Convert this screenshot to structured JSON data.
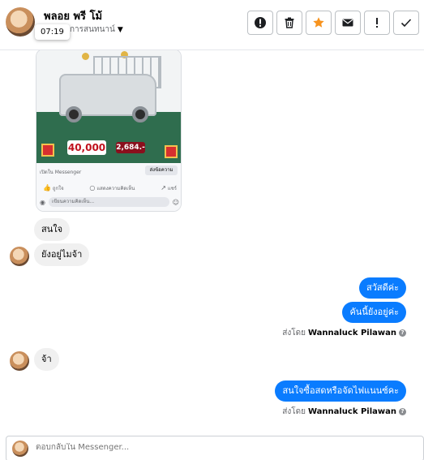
{
  "header": {
    "contact_name": "พลอย พรี โม้",
    "subtitle": "อการสนทนาน์",
    "tooltip_time": "07:19"
  },
  "toolbar": {
    "buttons": [
      {
        "icon": "alert-circle-icon"
      },
      {
        "icon": "trash-icon"
      },
      {
        "icon": "star-icon",
        "color": "#f7931e"
      },
      {
        "icon": "mail-icon"
      },
      {
        "icon": "exclamation-icon"
      },
      {
        "icon": "check-icon"
      }
    ]
  },
  "card": {
    "price_main": "40,000",
    "price_secondary": "2,684.-",
    "source": "เปิดใน Messenger",
    "button": "ส่งข้อความ",
    "actions": [
      "ถูกใจ",
      "แสดงความคิดเห็น",
      "แชร์"
    ],
    "comment_placeholder": "เขียนความคิดเห็น..."
  },
  "messages": [
    {
      "from": "them",
      "text": "สนใจ"
    },
    {
      "from": "them",
      "text": "ยังอยู่ไมจ้า"
    },
    {
      "from": "me",
      "text": "สวัสดีค่ะ"
    },
    {
      "from": "me",
      "text": "คันนี้ยังอยู่ค่ะ"
    },
    {
      "from": "them",
      "text": "จ้า"
    },
    {
      "from": "me",
      "text": "สนใจซื้อสดหรือจัดไฟแนนซ์คะ"
    }
  ],
  "sent_by": {
    "prefix": "ส่งโดย",
    "name": "Wannaluck Pilawan"
  },
  "composer": {
    "placeholder": "ตอบกลับใน Messenger..."
  }
}
